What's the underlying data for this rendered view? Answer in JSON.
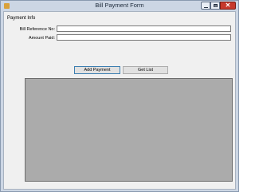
{
  "window": {
    "title": "Bill Payment Form",
    "controls": {
      "minimize": "minimize-icon",
      "maximize": "maximize-icon",
      "close": "close-icon"
    }
  },
  "form": {
    "section_label": "Payment Info",
    "bill_reference_label": "Bill Reference No:",
    "bill_reference_value": "",
    "amount_paid_label": "Amount Paid:",
    "amount_paid_value": "",
    "add_payment_label": "Add Payment",
    "get_list_label": "Get List"
  },
  "colors": {
    "window_frame": "#ccd6e4",
    "client_background": "#f0f0f0",
    "grid_background": "#ababab",
    "close_button": "#c7392c"
  }
}
